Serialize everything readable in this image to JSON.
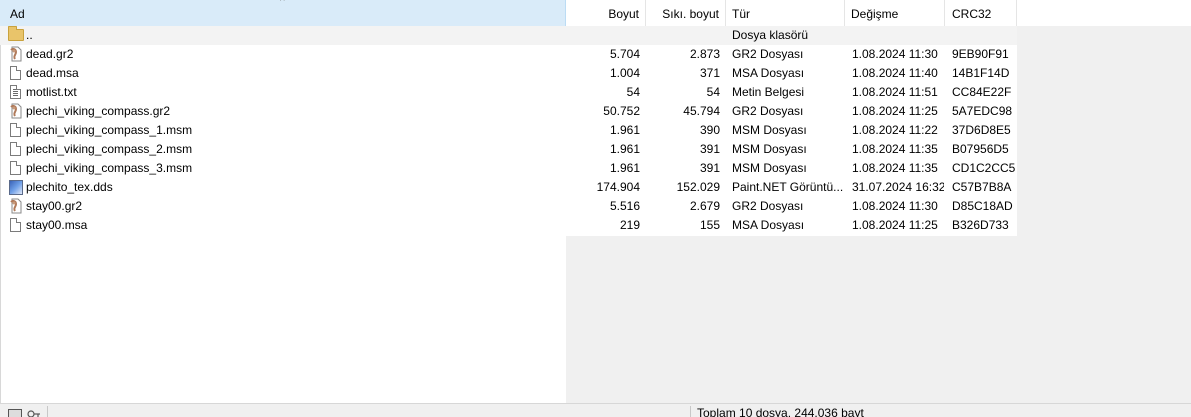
{
  "columns": {
    "name": "Ad",
    "size": "Boyut",
    "packed": "Sıkı. boyut",
    "type": "Tür",
    "modified": "Değişme",
    "crc": "CRC32"
  },
  "parent_row": {
    "name": "..",
    "type": "Dosya klasörü",
    "icon": "folder-icon"
  },
  "files": [
    {
      "name": "dead.gr2",
      "size": "5.704",
      "packed": "2.873",
      "type": "GR2 Dosyası",
      "modified": "1.08.2024 11:30",
      "crc": "9EB90F91",
      "icon": "gr2-file-icon"
    },
    {
      "name": "dead.msa",
      "size": "1.004",
      "packed": "371",
      "type": "MSA Dosyası",
      "modified": "1.08.2024 11:40",
      "crc": "14B1F14D",
      "icon": "file-icon"
    },
    {
      "name": "motlist.txt",
      "size": "54",
      "packed": "54",
      "type": "Metin Belgesi",
      "modified": "1.08.2024 11:51",
      "crc": "CC84E22F",
      "icon": "text-file-icon"
    },
    {
      "name": "plechi_viking_compass.gr2",
      "size": "50.752",
      "packed": "45.794",
      "type": "GR2 Dosyası",
      "modified": "1.08.2024 11:25",
      "crc": "5A7EDC98",
      "icon": "gr2-file-icon"
    },
    {
      "name": "plechi_viking_compass_1.msm",
      "size": "1.961",
      "packed": "390",
      "type": "MSM Dosyası",
      "modified": "1.08.2024 11:22",
      "crc": "37D6D8E5",
      "icon": "file-icon"
    },
    {
      "name": "plechi_viking_compass_2.msm",
      "size": "1.961",
      "packed": "391",
      "type": "MSM Dosyası",
      "modified": "1.08.2024 11:35",
      "crc": "B07956D5",
      "icon": "file-icon"
    },
    {
      "name": "plechi_viking_compass_3.msm",
      "size": "1.961",
      "packed": "391",
      "type": "MSM Dosyası",
      "modified": "1.08.2024 11:35",
      "crc": "CD1C2CC5",
      "icon": "file-icon"
    },
    {
      "name": "plechito_tex.dds",
      "size": "174.904",
      "packed": "152.029",
      "type": "Paint.NET Görüntü...",
      "modified": "31.07.2024 16:32",
      "crc": "C57B7B8A",
      "icon": "image-file-icon"
    },
    {
      "name": "stay00.gr2",
      "size": "5.516",
      "packed": "2.679",
      "type": "GR2 Dosyası",
      "modified": "1.08.2024 11:30",
      "crc": "D85C18AD",
      "icon": "gr2-file-icon"
    },
    {
      "name": "stay00.msa",
      "size": "219",
      "packed": "155",
      "type": "MSA Dosyası",
      "modified": "1.08.2024 11:25",
      "crc": "B326D733",
      "icon": "file-icon"
    }
  ],
  "status": {
    "summary": "Toplam 10 dosya, 244.036 bayt"
  },
  "colors": {
    "sorted_header": "#d9ebf9",
    "parent_row": "#f3f3f3",
    "empty_area": "#f0f0f0"
  }
}
